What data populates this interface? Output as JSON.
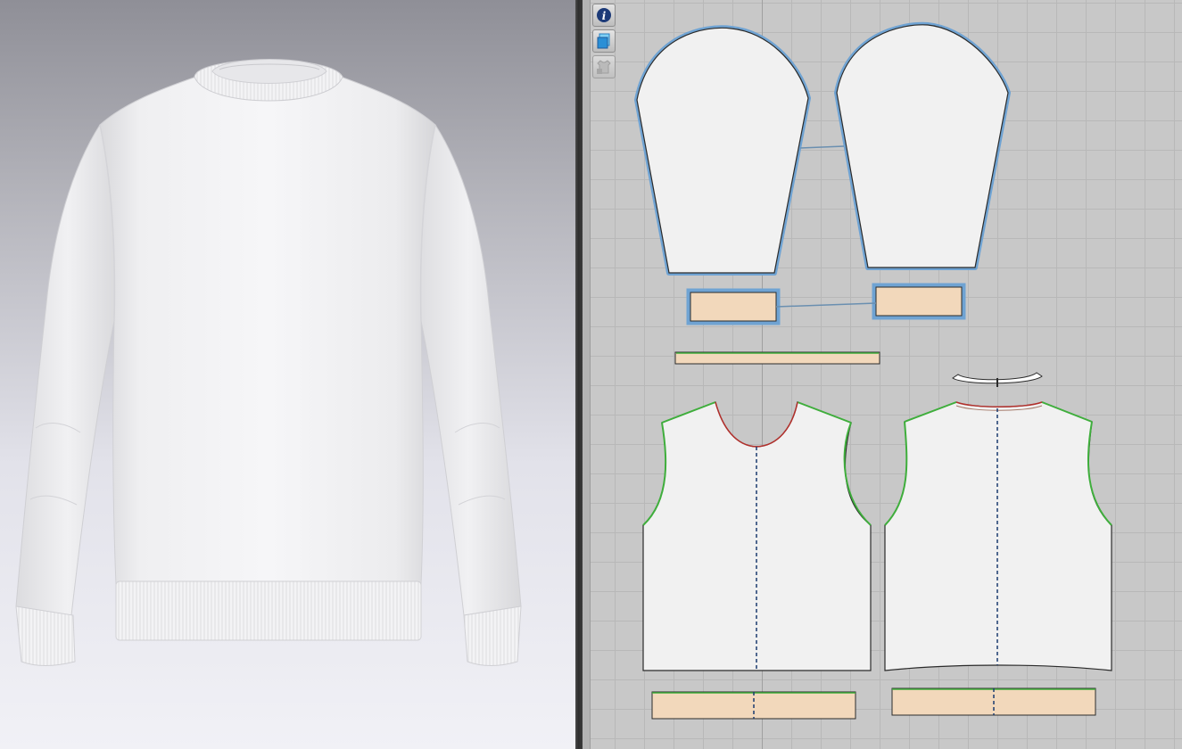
{
  "app": {
    "views": [
      "3d-garment-window",
      "2d-pattern-window"
    ]
  },
  "toolbar_2d": {
    "tools": [
      {
        "icon": "info-icon"
      },
      {
        "icon": "texture-layer-icon"
      },
      {
        "icon": "lock-avatar-icon"
      }
    ]
  },
  "garment": {
    "name": "",
    "color": "#ffffff"
  },
  "colors": {
    "fabric": "#f1f1f1",
    "rib": "#f2d8bb",
    "selected_outline": "#6fa3d3",
    "armhole_seam": "#3fae3c",
    "neckline_seam": "#b2302c",
    "center_line": "#1b3b6f"
  },
  "pattern_pieces": [
    {
      "id": "sleeve-left",
      "selected": true
    },
    {
      "id": "sleeve-right",
      "selected": true
    },
    {
      "id": "cuff-left",
      "selected": true
    },
    {
      "id": "cuff-right",
      "selected": true
    },
    {
      "id": "neck-rib",
      "selected": false
    },
    {
      "id": "front-body",
      "selected": false
    },
    {
      "id": "back-neck-facing",
      "selected": false
    },
    {
      "id": "back-body",
      "selected": false
    },
    {
      "id": "hem-rib-front",
      "selected": false
    },
    {
      "id": "hem-rib-back",
      "selected": false
    }
  ]
}
